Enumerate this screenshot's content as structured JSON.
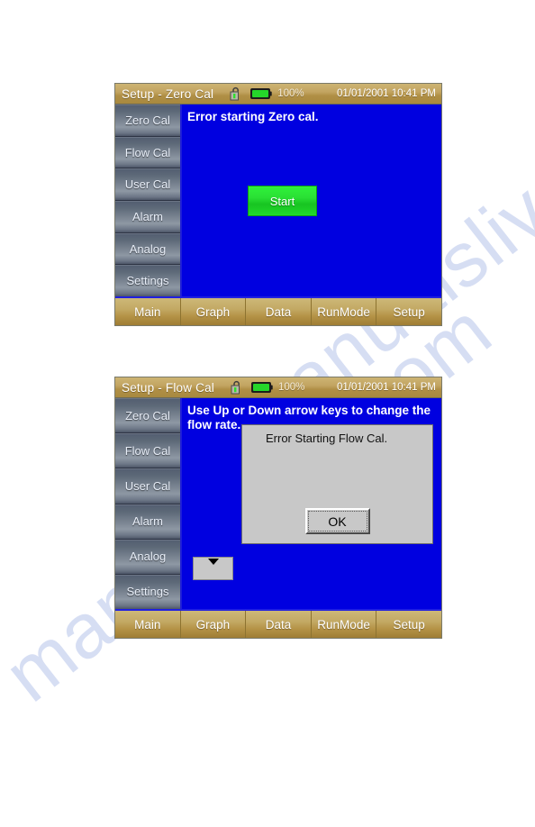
{
  "watermark": {
    "line_a": "manualslive.com",
    "line_b": "manualslive.com"
  },
  "screens": [
    {
      "id": "zero-cal",
      "titlebar": {
        "title": "Setup - Zero Cal",
        "lock_icon": "open-padlock-icon",
        "battery_icon": "battery-full-icon",
        "battery_percent": "100%",
        "datetime": "01/01/2001 10:41 PM"
      },
      "sidebar": {
        "items": [
          {
            "label": "Zero Cal"
          },
          {
            "label": "Flow Cal"
          },
          {
            "label": "User Cal"
          },
          {
            "label": "Alarm"
          },
          {
            "label": "Analog"
          },
          {
            "label": "Settings"
          }
        ]
      },
      "content": {
        "message": "Error starting Zero cal.",
        "start_button": "Start"
      },
      "tabs": [
        {
          "label": "Main"
        },
        {
          "label": "Graph"
        },
        {
          "label": "Data"
        },
        {
          "label": "RunMode"
        },
        {
          "label": "Setup"
        }
      ]
    },
    {
      "id": "flow-cal",
      "titlebar": {
        "title": "Setup - Flow Cal",
        "lock_icon": "open-padlock-icon",
        "battery_icon": "battery-full-icon",
        "battery_percent": "100%",
        "datetime": "01/01/2001 10:41 PM"
      },
      "sidebar": {
        "items": [
          {
            "label": "Zero Cal"
          },
          {
            "label": "Flow Cal"
          },
          {
            "label": "User Cal"
          },
          {
            "label": "Alarm"
          },
          {
            "label": "Analog"
          },
          {
            "label": "Settings"
          }
        ]
      },
      "content": {
        "message": "Use Up or Down arrow keys to change the flow rate.",
        "spinner_icon": "down-arrow-icon"
      },
      "dialog": {
        "message": "Error Starting Flow Cal.",
        "ok_label": "OK"
      },
      "tabs": [
        {
          "label": "Main"
        },
        {
          "label": "Graph"
        },
        {
          "label": "Data"
        },
        {
          "label": "RunMode"
        },
        {
          "label": "Setup"
        }
      ]
    }
  ],
  "colors": {
    "titlebar_gold": "#c2a460",
    "screen_blue": "#0000e0",
    "sidebar_slate": "#7d8794",
    "start_green": "#2ae035",
    "dialog_gray": "#c8c8c8",
    "tabbar_gold": "#b59347",
    "watermark_blue": "#c9d3ef"
  }
}
